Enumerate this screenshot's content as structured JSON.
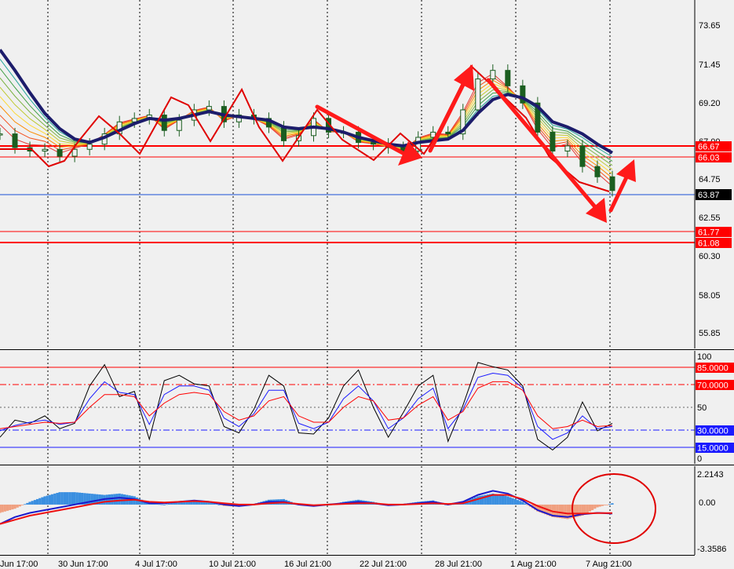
{
  "price_panel": {
    "y_ticks": [
      "73.65",
      "71.45",
      "69.20",
      "67.00",
      "64.75",
      "62.55",
      "60.30",
      "58.05",
      "55.85"
    ],
    "current_price": "63.87",
    "price_tags": [
      "66.67",
      "66.03",
      "61.77",
      "61.08"
    ],
    "colors": {
      "candle": "#2e7d32",
      "slow_ma": "#1c1c6b",
      "levels": "#ff0000",
      "price_line": "#1a4fd6"
    }
  },
  "stoch_panel": {
    "y_ticks": [
      "100",
      "50",
      "0"
    ],
    "level_tags": [
      "85.0000",
      "70.0000",
      "30.0000",
      "15.0000"
    ]
  },
  "macd_panel": {
    "y_ticks": [
      "2.2143",
      "0.00",
      "-3.3586"
    ]
  },
  "x_labels": [
    "Jun 17:00",
    "30 Jun 17:00",
    "4 Jul 17:00",
    "10 Jul 21:00",
    "16 Jul 21:00",
    "22 Jul 21:00",
    "28 Jul 21:00",
    "1 Aug 21:00",
    "7 Aug 21:00"
  ],
  "chart_data": [
    {
      "type": "line",
      "panel": "price",
      "ylim": [
        54.7,
        75.0
      ],
      "horizontal_levels": [
        66.67,
        66.03,
        61.77,
        61.08
      ],
      "last_price": 63.87,
      "series": [
        {
          "values": [
            67.2,
            66.4,
            66.2,
            66.3,
            65.9,
            66.3,
            66.6,
            67.2,
            67.9,
            68.1,
            68.3,
            67.4,
            68.0,
            68.6,
            68.8,
            67.9,
            68.3,
            68.1,
            67.6,
            66.8,
            67.1,
            68.1,
            67.3,
            67.3,
            66.7,
            66.6,
            66.4,
            66.2,
            67.0,
            67.3,
            67.2,
            68.6,
            70.4,
            70.9,
            70.0,
            69.0,
            67.3,
            66.2,
            66.5,
            65.3,
            64.7,
            63.9
          ]
        },
        {
          "values": [
            72.1,
            70.9,
            69.6,
            68.4,
            67.5,
            66.9,
            66.7,
            67.0,
            67.4,
            67.8,
            68.1,
            68.0,
            68.1,
            68.3,
            68.5,
            68.3,
            68.2,
            68.1,
            68.0,
            67.6,
            67.5,
            67.6,
            67.5,
            67.3,
            67.0,
            66.8,
            66.6,
            66.5,
            66.7,
            66.8,
            66.9,
            67.4,
            68.4,
            69.2,
            69.5,
            69.3,
            68.8,
            67.9,
            67.6,
            67.2,
            66.6,
            66.1
          ]
        }
      ]
    },
    {
      "type": "line",
      "panel": "stochastic",
      "ylim": [
        0,
        100
      ],
      "levels": [
        85,
        70,
        50,
        30,
        15
      ],
      "series": [
        {
          "values": [
            22,
            38,
            35,
            42,
            30,
            35,
            70,
            90,
            60,
            65,
            20,
            75,
            80,
            72,
            70,
            32,
            26,
            48,
            80,
            70,
            26,
            25,
            40,
            70,
            85,
            50,
            22,
            45,
            70,
            80,
            18,
            52,
            92,
            88,
            85,
            70,
            20,
            10,
            22,
            55,
            28,
            35
          ]
        },
        {
          "values": [
            28,
            33,
            36,
            38,
            34,
            36,
            58,
            74,
            64,
            62,
            34,
            62,
            70,
            70,
            66,
            40,
            32,
            44,
            66,
            66,
            35,
            30,
            36,
            58,
            70,
            56,
            30,
            40,
            58,
            68,
            30,
            48,
            78,
            82,
            80,
            68,
            32,
            20,
            26,
            42,
            30,
            32
          ]
        },
        {
          "values": [
            30,
            32,
            34,
            36,
            35,
            36,
            50,
            62,
            62,
            60,
            42,
            54,
            62,
            64,
            62,
            46,
            38,
            42,
            56,
            60,
            42,
            36,
            36,
            50,
            60,
            56,
            38,
            40,
            52,
            60,
            38,
            46,
            68,
            74,
            74,
            66,
            42,
            30,
            32,
            38,
            32,
            33
          ]
        }
      ]
    },
    {
      "type": "bar",
      "panel": "macd",
      "ylim": [
        -3.3586,
        2.2143
      ],
      "histogram": [
        -0.6,
        -0.3,
        0.2,
        0.6,
        0.9,
        0.9,
        0.8,
        0.7,
        0.8,
        0.6,
        0.1,
        0.0,
        0.2,
        0.3,
        0.2,
        -0.1,
        -0.15,
        0.05,
        0.35,
        0.4,
        0.0,
        -0.1,
        -0.05,
        0.2,
        0.35,
        0.2,
        -0.05,
        0.05,
        0.2,
        0.3,
        -0.05,
        0.2,
        0.6,
        0.8,
        0.6,
        0.2,
        -0.5,
        -0.9,
        -1.05,
        -0.8,
        -0.2,
        0.1
      ],
      "series": [
        {
          "values": [
            -1.4,
            -0.9,
            -0.6,
            -0.4,
            -0.2,
            0.0,
            0.2,
            0.4,
            0.5,
            0.4,
            0.1,
            0.1,
            0.2,
            0.3,
            0.2,
            0.0,
            -0.1,
            0.0,
            0.2,
            0.2,
            0.0,
            -0.1,
            0.0,
            0.1,
            0.2,
            0.1,
            -0.05,
            0.0,
            0.1,
            0.2,
            0.0,
            0.2,
            0.7,
            1.0,
            0.8,
            0.3,
            -0.4,
            -0.8,
            -0.9,
            -0.7,
            -0.6,
            -0.65
          ]
        },
        {
          "values": [
            -1.4,
            -1.1,
            -0.8,
            -0.6,
            -0.4,
            -0.2,
            0.0,
            0.2,
            0.3,
            0.35,
            0.2,
            0.15,
            0.2,
            0.25,
            0.2,
            0.1,
            0.0,
            0.0,
            0.1,
            0.15,
            0.05,
            -0.05,
            0.0,
            0.05,
            0.1,
            0.1,
            0.0,
            0.0,
            0.05,
            0.1,
            0.05,
            0.1,
            0.4,
            0.7,
            0.7,
            0.4,
            -0.1,
            -0.5,
            -0.65,
            -0.65,
            -0.62,
            -0.62
          ]
        }
      ]
    }
  ]
}
